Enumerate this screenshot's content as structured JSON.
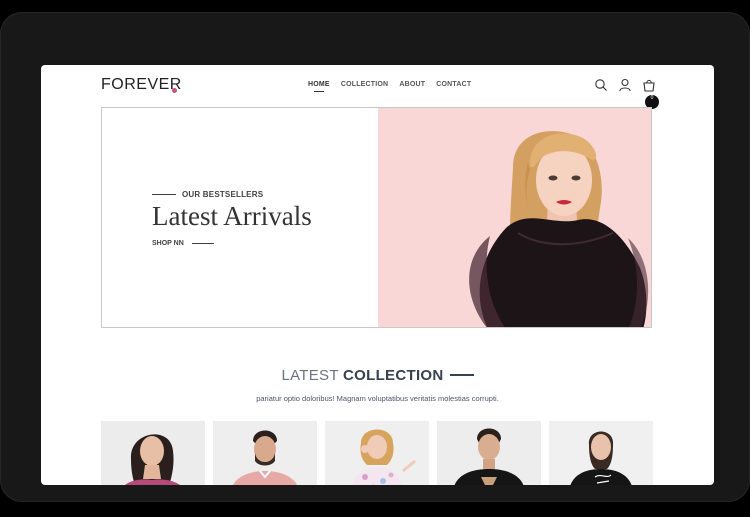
{
  "brand": {
    "name": "FOREVER",
    "accent_color": "#c8557e"
  },
  "nav": {
    "items": [
      {
        "label": "HOME",
        "active": true
      },
      {
        "label": "COLLECTION",
        "active": false
      },
      {
        "label": "ABOUT",
        "active": false
      },
      {
        "label": "CONTACT",
        "active": false
      }
    ],
    "icons": [
      "search-icon",
      "profile-icon",
      "cart-icon"
    ],
    "cart_count": "0"
  },
  "hero": {
    "kicker": "OUR BESTSELLERS",
    "title": "Latest Arrivals",
    "cta": "SHOP NN",
    "image_bg": "#f8d7d6"
  },
  "collection": {
    "title_light": "LATEST",
    "title_bold": "COLLECTION",
    "subtitle": "pariatur optio doloribus! Magnam voluptatibus veritatis molestias corrupti."
  },
  "products": [
    {
      "image": "woman-offshoulder-top"
    },
    {
      "image": "man-pink-shirt"
    },
    {
      "image": "girl-floral-dress"
    },
    {
      "image": "man-black-tshirt"
    },
    {
      "image": "woman-black-tshirt"
    }
  ]
}
